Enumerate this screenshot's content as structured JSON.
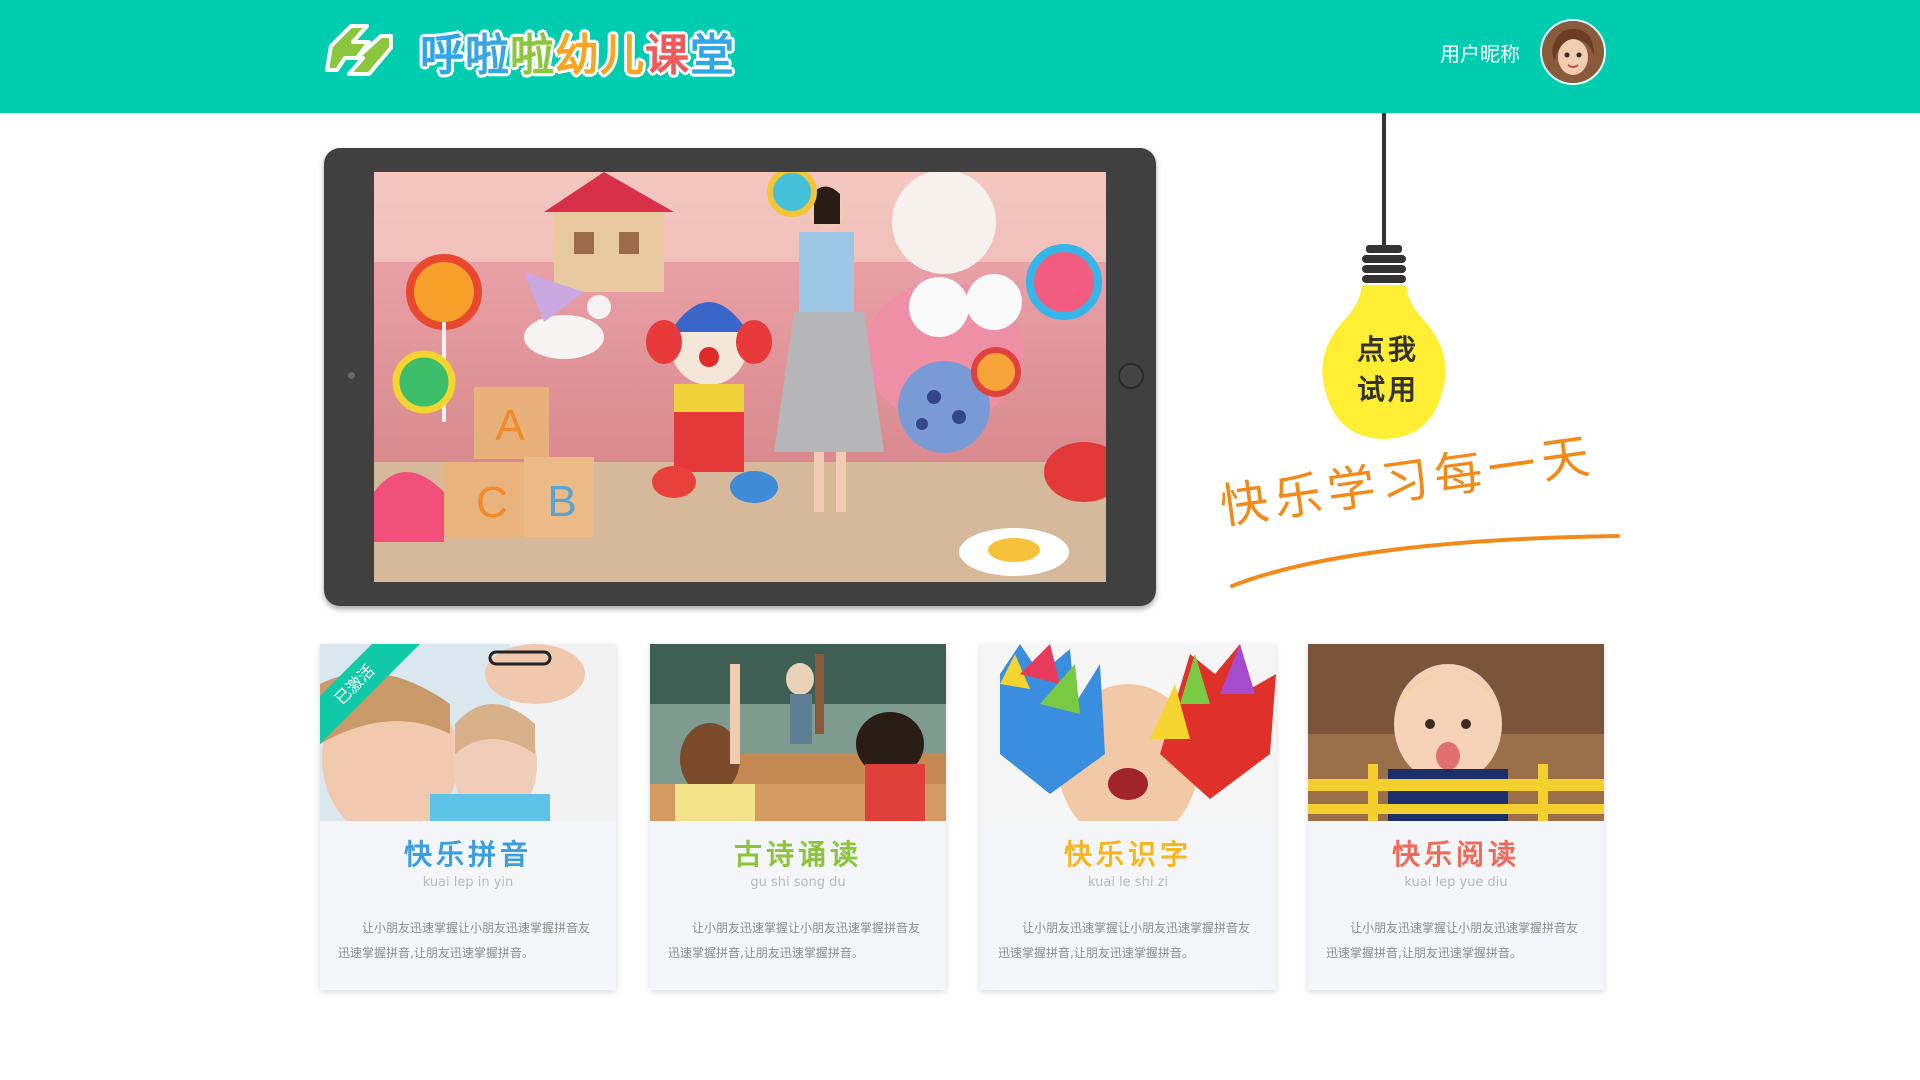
{
  "header": {
    "brand_chars": [
      {
        "ch": "呼",
        "color": "#2fa6e8"
      },
      {
        "ch": "啦",
        "color": "#3aa6e0"
      },
      {
        "ch": "啦",
        "color": "#8cc63f"
      },
      {
        "ch": "幼",
        "color": "#f5a623"
      },
      {
        "ch": "儿",
        "color": "#f5a623"
      },
      {
        "ch": "课",
        "color": "#ef5a5a"
      },
      {
        "ch": "堂",
        "color": "#2fa6e8"
      }
    ],
    "user_name": "用户昵称",
    "bg_color": "#00cdb0"
  },
  "trial": {
    "bulb_text_line1": "点我",
    "bulb_text_line2": "试用",
    "bulb_color": "#ffee33"
  },
  "slogan": "快乐学习每一天",
  "cards": [
    {
      "title": "快乐拼音",
      "pinyin": "kuai lep in yin",
      "desc": "让小朋友迅速掌握让小朋友迅速掌握拼音友迅速掌握拼音,让朋友迅速掌握拼音。",
      "color": "#3a9ee0",
      "badge": "已激活"
    },
    {
      "title": "古诗诵读",
      "pinyin": "gu shi song du",
      "desc": "让小朋友迅速掌握让小朋友迅速掌握拼音友迅速掌握拼音,让朋友迅速掌握拼音。",
      "color": "#8cc43c"
    },
    {
      "title": "快乐识字",
      "pinyin": "kuai le shi zi",
      "desc": "让小朋友迅速掌握让小朋友迅速掌握拼音友迅速掌握拼音,让朋友迅速掌握拼音。",
      "color": "#f7b51e"
    },
    {
      "title": "快乐阅读",
      "pinyin": "kuai lep yue diu",
      "desc": "让小朋友迅速掌握让小朋友迅速掌握拼音友迅速掌握拼音,让朋友迅速掌握拼音。",
      "color": "#f06a5a"
    }
  ]
}
